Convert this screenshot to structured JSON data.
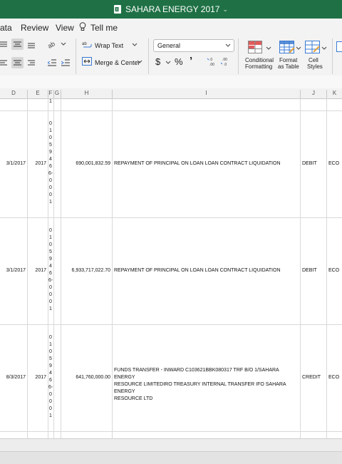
{
  "window": {
    "title": "SAHARA ENERGY 2017"
  },
  "menu": [
    "ata",
    "Review",
    "View"
  ],
  "tell_me": "Tell me",
  "ribbon": {
    "wrap_text": "Wrap Text",
    "merge_center": "Merge & Center",
    "number_format": "General",
    "conditional_formatting": [
      "Conditional",
      "Formatting"
    ],
    "format_as_table": [
      "Format",
      "as Table"
    ],
    "cell_styles": [
      "Cell",
      "Styles"
    ]
  },
  "columns": [
    "D",
    "E",
    "F",
    "G",
    "H",
    "I",
    "J",
    "K"
  ],
  "top_row_digit": "1",
  "rows": [
    {
      "date": "3/1/2017",
      "year": "2017",
      "ref": [
        "0",
        "1",
        "0",
        "5",
        "9",
        "4",
        "6",
        "6-",
        "0",
        "0",
        "0",
        "1"
      ],
      "amount": "690,001,832.59",
      "desc": [
        "REPAYMENT OF PRINCIPAL ON LOAN LOAN CONTRACT LIQUIDATION"
      ],
      "type": "DEBIT",
      "k": "ECO"
    },
    {
      "date": "3/1/2017",
      "year": "2017",
      "ref": [
        "0",
        "1",
        "0",
        "5",
        "9",
        "4",
        "6",
        "6-",
        "0",
        "0",
        "0",
        "1"
      ],
      "amount": "6,933,717,022.70",
      "desc": [
        "REPAYMENT OF PRINCIPAL ON LOAN LOAN CONTRACT LIQUIDATION"
      ],
      "type": "DEBIT",
      "k": "ECO"
    },
    {
      "date": "8/3/2017",
      "year": "2017",
      "ref": [
        "0",
        "1",
        "0",
        "5",
        "9",
        "4",
        "6",
        "6-",
        "0",
        "0",
        "0",
        "1"
      ],
      "amount": "641,760,000.00",
      "desc": [
        "FUNDS TRANSFER - INWARD C103621BBK080317 TRF B/O 1/SAHARA ENERGY",
        "RESOURCE LIMITEDIRO TREASURY INTERNAL TRANSFER IFO SAHARA ENERGY",
        "RESOURCE LTD"
      ],
      "type": "CREDIT",
      "k": "ECO"
    }
  ]
}
